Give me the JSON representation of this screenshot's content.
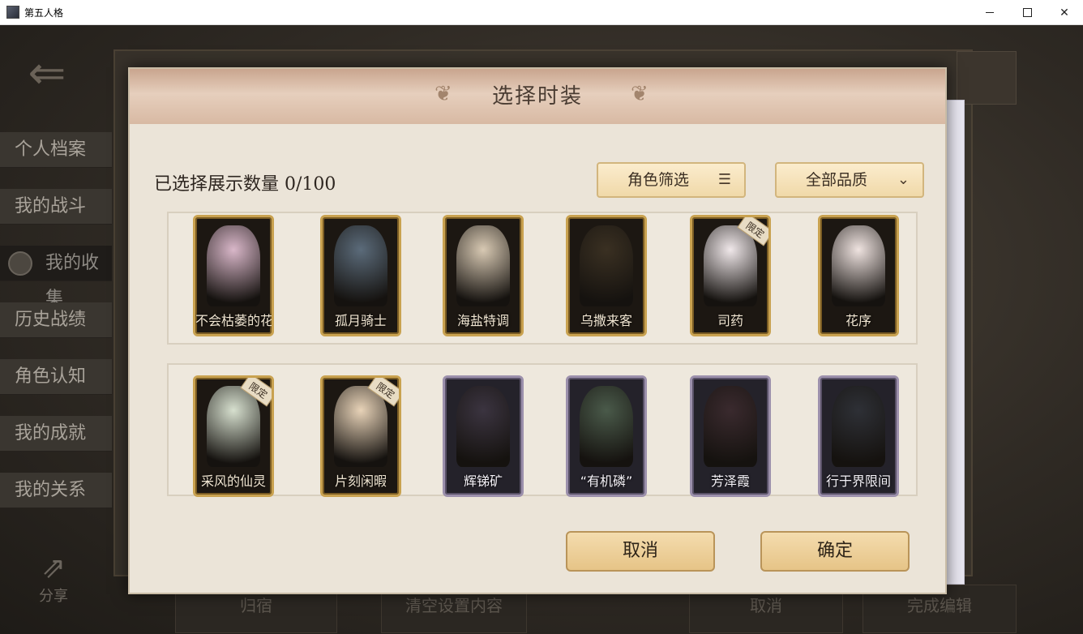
{
  "window": {
    "title": "第五人格",
    "controls": [
      "minimize",
      "maximize",
      "close"
    ]
  },
  "sidebar": {
    "items": [
      {
        "label": "个人档案",
        "active": false
      },
      {
        "label": "我的战斗",
        "active": false
      },
      {
        "label": "我的收集",
        "active": true
      },
      {
        "label": "历史战绩",
        "active": false
      },
      {
        "label": "角色认知",
        "active": false
      },
      {
        "label": "我的成就",
        "active": false
      },
      {
        "label": "我的关系",
        "active": false
      }
    ],
    "share_label": "分享"
  },
  "bottom_bar": {
    "items": [
      "归宿",
      "清空设置内容",
      "取消",
      "完成编辑"
    ]
  },
  "dialog": {
    "title": "选择时装",
    "selected_label": "已选择展示数量",
    "selected_count": "0/100",
    "filter_role": "角色筛选",
    "filter_quality": "全部品质",
    "cancel_label": "取消",
    "confirm_label": "确定",
    "costumes_row1": [
      {
        "name": "不会枯萎的花",
        "frame": "gold",
        "badge": ""
      },
      {
        "name": "孤月骑士",
        "frame": "gold",
        "badge": ""
      },
      {
        "name": "海盐特调",
        "frame": "gold",
        "badge": ""
      },
      {
        "name": "乌撒来客",
        "frame": "gold",
        "badge": ""
      },
      {
        "name": "司药",
        "frame": "gold",
        "badge": "限定"
      },
      {
        "name": "花序",
        "frame": "gold",
        "badge": ""
      }
    ],
    "costumes_row2": [
      {
        "name": "采风的仙灵",
        "frame": "gold",
        "badge": "限定"
      },
      {
        "name": "片刻闲暇",
        "frame": "gold",
        "badge": "限定"
      },
      {
        "name": "辉锑矿",
        "frame": "purple",
        "badge": ""
      },
      {
        "name": "“有机磷”",
        "frame": "purple",
        "badge": ""
      },
      {
        "name": "芳泽霞",
        "frame": "purple",
        "badge": ""
      },
      {
        "name": "行于界限间",
        "frame": "purple",
        "badge": ""
      }
    ]
  },
  "colors": {
    "gold_frame": "#c9a250",
    "purple_frame": "#9c90ac",
    "dialog_bg": "#ebe4d8",
    "button_bg": "#f0d9a9"
  }
}
